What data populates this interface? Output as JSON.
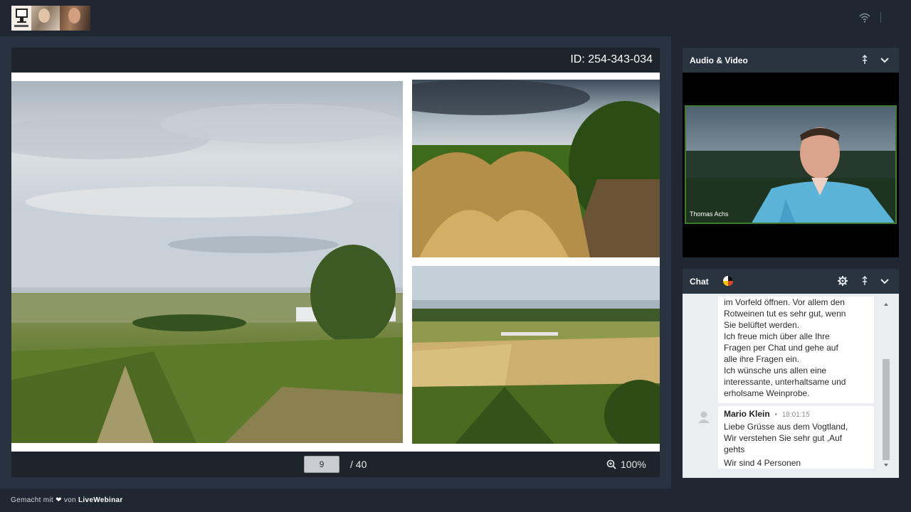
{
  "header": {
    "logo_alt": "Webinar logo",
    "icons": [
      "wifi-icon"
    ]
  },
  "presentation": {
    "meeting_id": "ID: 254-343-034",
    "page_current": "9",
    "page_total": "/ 40",
    "zoom": "100%"
  },
  "audio_video": {
    "title": "Audio & Video",
    "participant_name": "Thomas Achs"
  },
  "chat": {
    "title": "Chat",
    "messages": [
      {
        "lines": [
          "im Vorfeld öffnen. Vor allem den",
          "Rotweinen tut es sehr gut, wenn",
          "Sie belüftet werden.",
          "Ich freue mich über alle Ihre",
          "Fragen per Chat und gehe auf",
          "alle ihre Fragen ein.",
          "Ich wünsche uns allen eine",
          "interessante, unterhaltsame und",
          "erholsame Weinprobe."
        ]
      },
      {
        "author": "Mario Klein",
        "time": "18:01:15",
        "lines": [
          "Liebe Grüsse aus dem Vogtland,",
          "Wir verstehen Sie sehr gut ,Auf",
          "gehts"
        ],
        "extra": "Wir sind 4 Personen"
      }
    ]
  },
  "footer": {
    "prefix": "Gemacht mit",
    "by": "von",
    "brand": "LiveWebinar"
  },
  "colors": {
    "background": "#1f2732",
    "panel_header": "#2a3441",
    "video_border": "#3e7b30"
  }
}
